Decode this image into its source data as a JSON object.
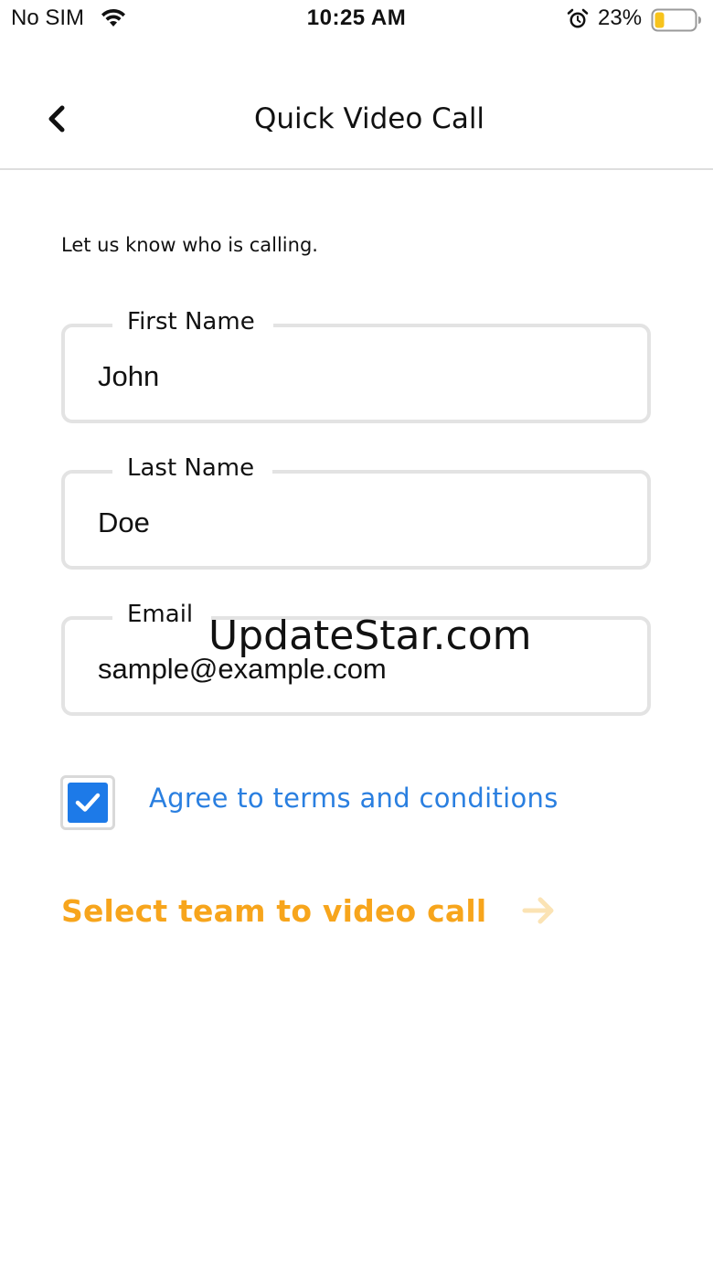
{
  "status_bar": {
    "carrier": "No SIM",
    "time": "10:25 AM",
    "battery_percent": "23%",
    "battery_level": 0.23,
    "battery_color": "#f7c31c",
    "icons": [
      "wifi-icon",
      "alarm-icon",
      "battery-icon"
    ]
  },
  "nav": {
    "title": "Quick Video Call",
    "back_icon": "chevron-left-icon"
  },
  "form": {
    "intro": "Let us know who is calling.",
    "fields": [
      {
        "label": "First Name",
        "value": "John"
      },
      {
        "label": "Last Name",
        "value": "Doe"
      },
      {
        "label": "Email",
        "value": "sample@example.com"
      }
    ],
    "terms": {
      "label": "Agree to terms and conditions",
      "checked": true,
      "color": "#2a7fe0",
      "checkbox_color": "#1d7ae8"
    },
    "cta": {
      "label": "Select team to video call",
      "icon": "arrow-right-icon",
      "color": "#f7a51c"
    }
  },
  "watermark": "UpdateStar.com"
}
